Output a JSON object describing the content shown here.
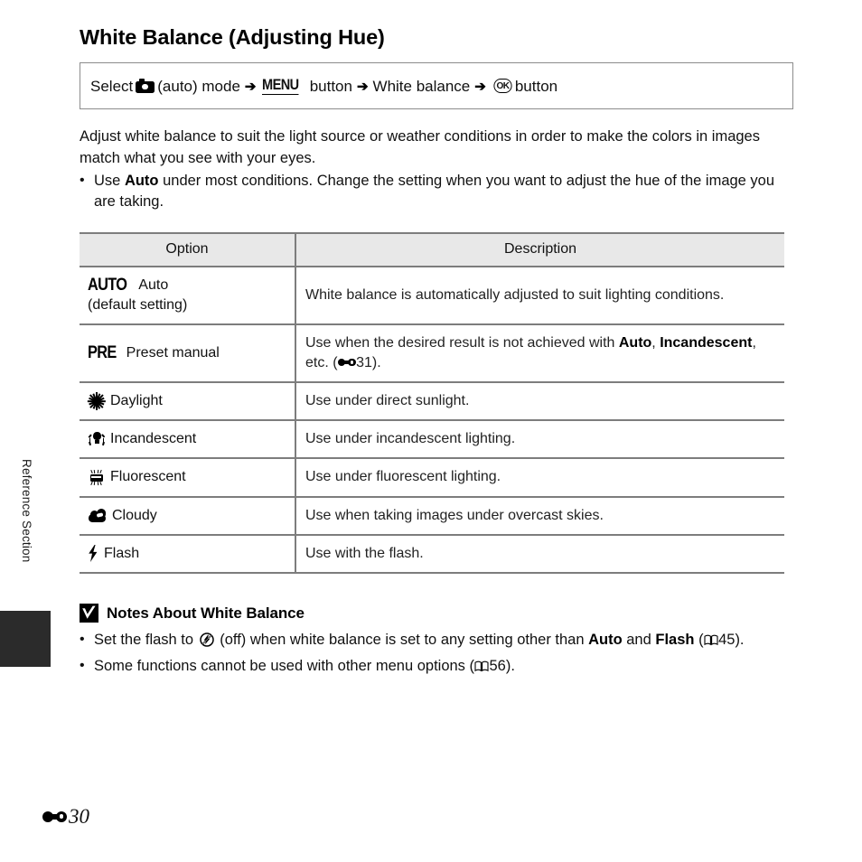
{
  "side_tab": {
    "label": "Reference Section"
  },
  "header": {
    "title": "White Balance (Adjusting Hue)"
  },
  "nav_path": {
    "select_label": "Select",
    "camera_icon": "camera-icon",
    "mode_label": "(auto) mode",
    "arrow": "➔",
    "menu_glyph": "MENU",
    "menu_button_label": "button",
    "white_balance_label": "White balance",
    "ok_glyph": "OK",
    "ok_button_label": "button"
  },
  "intro": {
    "paragraph": "Adjust white balance to suit the light source or weather conditions in order to make the colors in images match what you see with your eyes.",
    "bullet_dot": "•",
    "bullet_part1": "Use ",
    "bullet_bold": "Auto",
    "bullet_part2": " under most conditions. Change the setting when you want to adjust the hue of the image you are taking."
  },
  "table": {
    "columns": [
      "Option",
      "Description"
    ],
    "rows": [
      {
        "glyph": "AUTO",
        "icon": "",
        "name": "Auto",
        "sub": "(default setting)",
        "description": "White balance is automatically adjusted to suit lighting conditions."
      },
      {
        "glyph": "PRE",
        "icon": "",
        "name": "Preset manual",
        "sub": "",
        "desc_part1": "Use when the desired result is not achieved with ",
        "desc_bold1": "Auto",
        "desc_part2": ", ",
        "desc_bold2": "Incandescent",
        "desc_part3": ", etc. (",
        "desc_ref_page": "31",
        "desc_part4": ")."
      },
      {
        "glyph": "",
        "icon": "sun-icon",
        "name": "Daylight",
        "sub": "",
        "description": "Use under direct sunlight."
      },
      {
        "glyph": "",
        "icon": "incandescent-bulb-icon",
        "name": "Incandescent",
        "sub": "",
        "description": "Use under incandescent lighting."
      },
      {
        "glyph": "",
        "icon": "fluorescent-tube-icon",
        "name": "Fluorescent",
        "sub": "",
        "description": "Use under fluorescent lighting."
      },
      {
        "glyph": "",
        "icon": "cloud-icon",
        "name": "Cloudy",
        "sub": "",
        "description": "Use when taking images under overcast skies."
      },
      {
        "glyph": "",
        "icon": "flash-bolt-icon",
        "name": "Flash",
        "sub": "",
        "description": "Use with the flash."
      }
    ]
  },
  "notes": {
    "badge_icon": "checkmark-badge-icon",
    "title": "Notes About White Balance",
    "bullet_dot": "•",
    "items": [
      {
        "part1": "Set the flash to ",
        "flash_off_icon": "flash-off-icon",
        "part2": " (off) when white balance is set to any setting other than ",
        "bold1": "Auto",
        "part3": " and ",
        "bold2": "Flash",
        "part4": " (",
        "book_page": "45",
        "part5": ")."
      },
      {
        "part1": "Some functions cannot be used with other menu options (",
        "book_page": "56",
        "part5": ")."
      }
    ]
  },
  "footer": {
    "ref_icon": "reference-section-icon",
    "page_number": "30"
  }
}
